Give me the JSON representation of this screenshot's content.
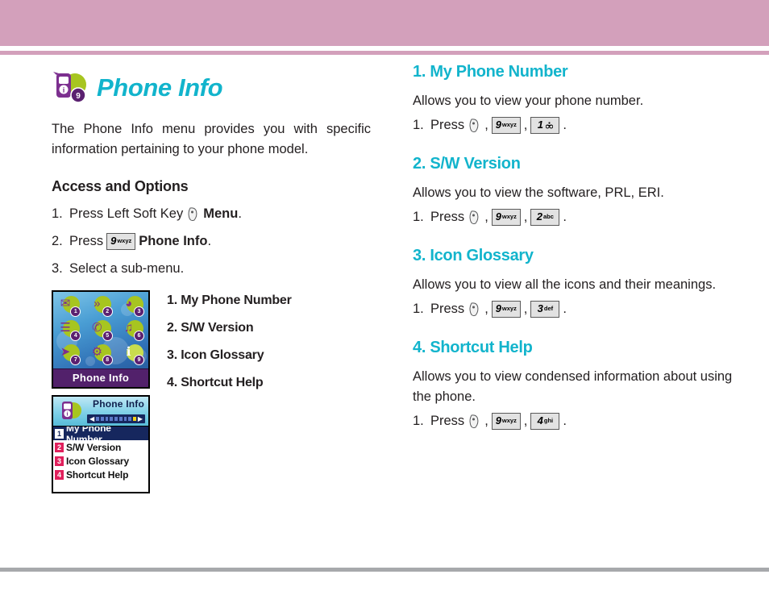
{
  "page": {
    "header_color": "#d3a0bb",
    "footer_rule_color": "#a7a9ac",
    "accent_color": "#12b4cc"
  },
  "title": {
    "text": "Phone Info",
    "icon": "phone-info-icon",
    "icon_badge": "9"
  },
  "intro": "The Phone Info menu provides you with specific information pertaining to your phone model.",
  "access": {
    "heading": "Access and Options",
    "steps": [
      {
        "num": "1.",
        "before": "Press Left Soft Key",
        "key_type": "softkey",
        "after": "Menu",
        "after_bold": true,
        "period": "."
      },
      {
        "num": "2.",
        "before": "Press",
        "key_type": "numkey",
        "key_digit": "9",
        "key_letters": "wxyz",
        "after": "Phone Info",
        "after_bold": true,
        "period": "."
      },
      {
        "num": "3.",
        "before": "Select a sub-menu.",
        "key_type": "none",
        "after": "",
        "period": ""
      }
    ]
  },
  "menu_list": [
    "1. My Phone Number",
    "2. S/W Version",
    "3. Icon Glossary",
    "4. Shortcut Help"
  ],
  "screenshot_main_menu": {
    "title": "Phone Info",
    "icons": [
      {
        "badge": "1",
        "name": "messaging-icon",
        "glyph": "✉"
      },
      {
        "badge": "2",
        "name": "get-it-now-icon",
        "glyph": "»"
      },
      {
        "badge": "3",
        "name": "browser-icon",
        "glyph": "◕"
      },
      {
        "badge": "4",
        "name": "contacts-icon",
        "glyph": "☰"
      },
      {
        "badge": "5",
        "name": "recent-calls-icon",
        "glyph": "✆"
      },
      {
        "badge": "6",
        "name": "media-center-icon",
        "glyph": "♫"
      },
      {
        "badge": "7",
        "name": "settings-tools-icon",
        "glyph": "➤"
      },
      {
        "badge": "8",
        "name": "tools-icon",
        "glyph": "⚙"
      },
      {
        "badge": "9",
        "name": "phone-info-icon",
        "glyph": "ℹ",
        "selected": true
      }
    ]
  },
  "screenshot_submenu": {
    "title": "Phone Info",
    "icon": "phone-info-icon",
    "scroll_pips": 9,
    "scroll_active_index": 8,
    "rows": [
      {
        "badge": "1",
        "label": "My Phone Number",
        "selected": true
      },
      {
        "badge": "2",
        "label": "S/W Version",
        "selected": false
      },
      {
        "badge": "3",
        "label": "Icon Glossary",
        "selected": false
      },
      {
        "badge": "4",
        "label": "Shortcut Help",
        "selected": false
      }
    ]
  },
  "sections": [
    {
      "heading": "1. My Phone Number",
      "desc": "Allows you to view your phone number.",
      "step_num": "1.",
      "step_label": "Press",
      "keys": [
        {
          "type": "softkey"
        },
        {
          "type": "numkey",
          "digit": "9",
          "letters": "wxyz"
        },
        {
          "type": "numkey",
          "digit": "1",
          "letters": "",
          "voicemail": true
        }
      ]
    },
    {
      "heading": "2. S/W Version",
      "desc": "Allows you to view the software, PRL, ERI.",
      "step_num": "1.",
      "step_label": "Press",
      "keys": [
        {
          "type": "softkey"
        },
        {
          "type": "numkey",
          "digit": "9",
          "letters": "wxyz"
        },
        {
          "type": "numkey",
          "digit": "2",
          "letters": "abc"
        }
      ]
    },
    {
      "heading": "3. Icon Glossary",
      "desc": "Allows you to view all the icons and their meanings.",
      "step_num": "1.",
      "step_label": "Press",
      "keys": [
        {
          "type": "softkey"
        },
        {
          "type": "numkey",
          "digit": "9",
          "letters": "wxyz"
        },
        {
          "type": "numkey",
          "digit": "3",
          "letters": "def"
        }
      ]
    },
    {
      "heading": "4. Shortcut Help",
      "desc": "Allows you to view condensed information about using the phone.",
      "step_num": "1.",
      "step_label": "Press",
      "keys": [
        {
          "type": "softkey"
        },
        {
          "type": "numkey",
          "digit": "9",
          "letters": "wxyz"
        },
        {
          "type": "numkey",
          "digit": "4",
          "letters": "ghi"
        }
      ]
    }
  ]
}
